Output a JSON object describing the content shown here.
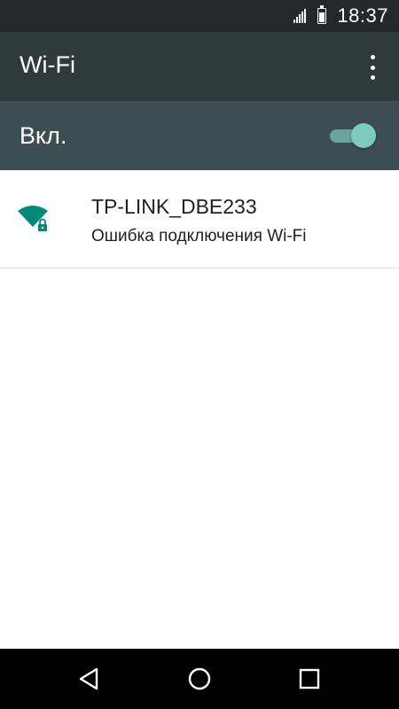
{
  "status_bar": {
    "time": "18:37",
    "icons": [
      "signal-icon",
      "battery-icon"
    ]
  },
  "toolbar": {
    "title": "Wi-Fi",
    "overflow_icon": "more-vert-icon"
  },
  "wifi_switch": {
    "label": "Вкл.",
    "enabled": true,
    "accent_color": "#7dcbc0"
  },
  "networks": [
    {
      "ssid": "TP-LINK_DBE233",
      "status": "Ошибка подключения Wi-Fi",
      "icon": "wifi-lock-icon",
      "signal_level": 1.0,
      "secured": true,
      "icon_color": "#00897b"
    }
  ],
  "nav_bar": {
    "buttons": [
      "back-icon",
      "home-icon",
      "recents-icon"
    ]
  },
  "colors": {
    "status_bar_bg": "#22282b",
    "toolbar_bg": "#2f3a3f",
    "switch_bar_bg": "#3d4d54"
  }
}
